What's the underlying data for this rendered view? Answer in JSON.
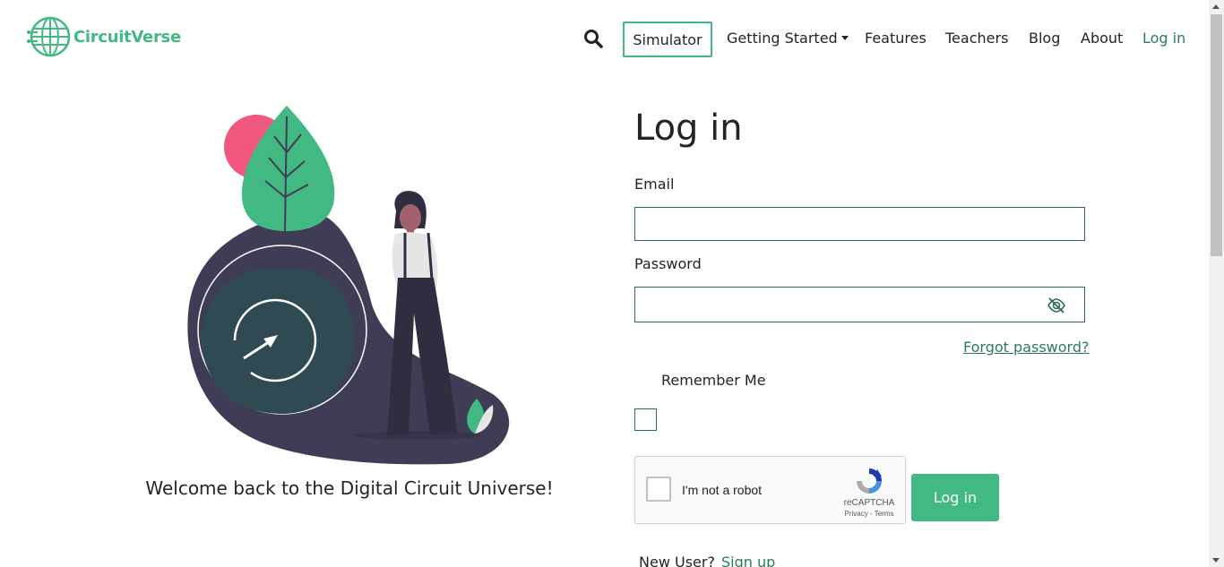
{
  "brand": {
    "name": "CircuitVerse",
    "color": "#42b983"
  },
  "nav": {
    "search_icon": "search-icon",
    "simulator": "Simulator",
    "getting_started": "Getting Started",
    "features": "Features",
    "teachers": "Teachers",
    "blog": "Blog",
    "about": "About",
    "login": "Log in"
  },
  "illustration": {
    "caption": "Welcome back to the Digital Circuit Universe!"
  },
  "form": {
    "title": "Log in",
    "email_label": "Email",
    "email_value": "",
    "password_label": "Password",
    "password_value": "",
    "password_toggle_icon": "eye-slash-icon",
    "forgot": "Forgot password?",
    "remember": "Remember Me",
    "remember_checked": false,
    "submit": "Log in",
    "new_user": "New User?",
    "signup": "Sign up"
  },
  "recaptcha": {
    "label": "I'm not a robot",
    "brand": "reCAPTCHA",
    "terms": "Privacy - Terms"
  },
  "colors": {
    "accent": "#42b983",
    "link": "#2b7a58",
    "field_border": "#2b6a55",
    "dark_blob": "#3f3d56",
    "circle_fill": "#2f4a53",
    "pink": "#f05880"
  }
}
